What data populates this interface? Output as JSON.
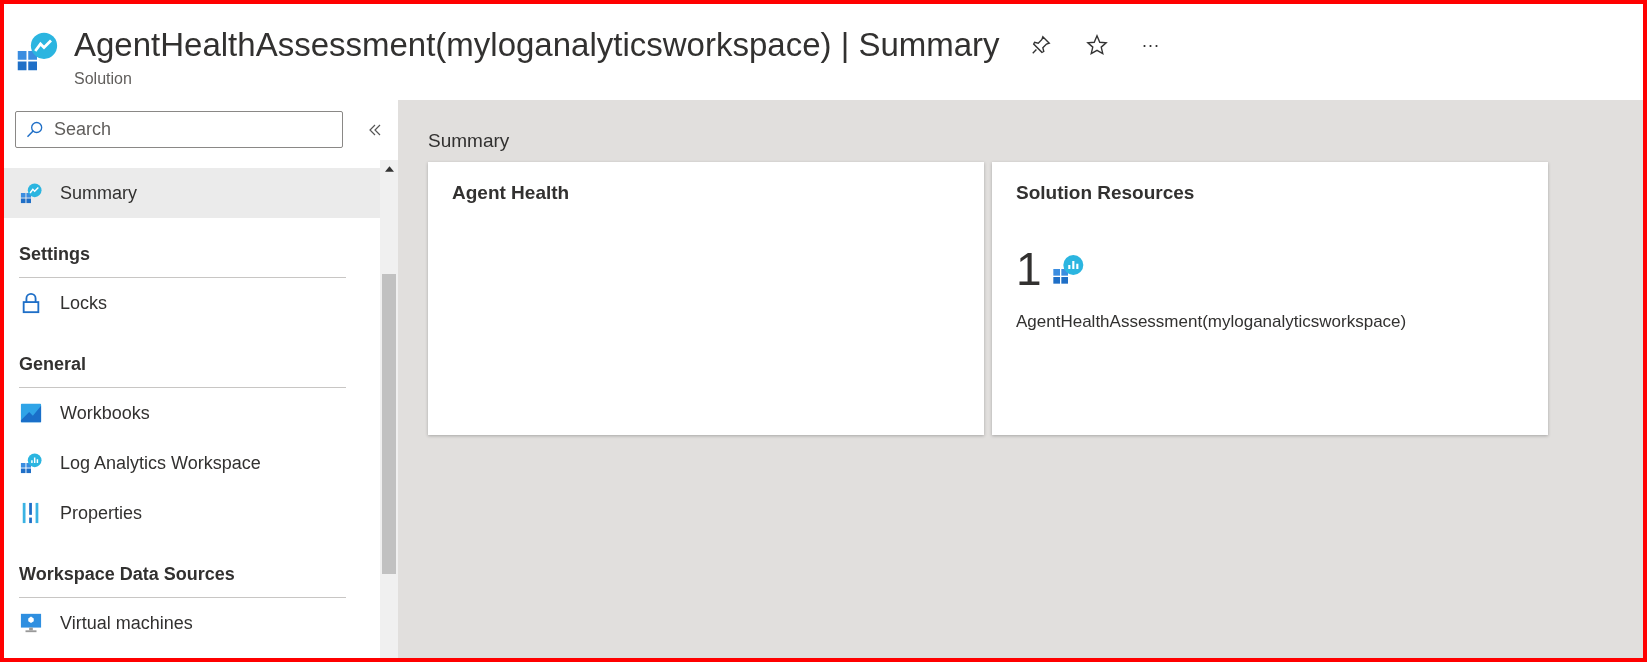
{
  "header": {
    "title": "AgentHealthAssessment(myloganalyticsworkspace) | Summary",
    "subtitle": "Solution",
    "actions": [
      {
        "kind": "pin"
      },
      {
        "kind": "star"
      },
      {
        "kind": "more",
        "label": "···"
      }
    ]
  },
  "sidebar": {
    "search": {
      "placeholder": "Search"
    },
    "items": [
      {
        "kind": "solution",
        "label": "Summary",
        "selected": true
      },
      {
        "kind": "section",
        "label": "Settings"
      },
      {
        "kind": "lock",
        "label": "Locks",
        "selected": false
      },
      {
        "kind": "section",
        "label": "General"
      },
      {
        "kind": "workbook",
        "label": "Workbooks",
        "selected": false
      },
      {
        "kind": "workspace",
        "label": "Log Analytics Workspace",
        "selected": false
      },
      {
        "kind": "properties",
        "label": "Properties",
        "selected": false
      },
      {
        "kind": "section",
        "label": "Workspace Data Sources"
      },
      {
        "kind": "vm",
        "label": "Virtual machines",
        "selected": false
      }
    ]
  },
  "main": {
    "heading": "Summary",
    "cards": [
      {
        "title": "Agent Health"
      },
      {
        "title": "Solution Resources",
        "count": "1",
        "resource": "AgentHealthAssessment(myloganalyticsworkspace)"
      }
    ]
  }
}
